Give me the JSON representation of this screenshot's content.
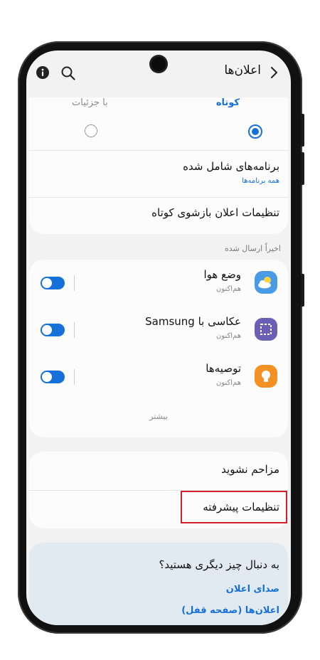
{
  "header": {
    "title": "اعلان‌ها"
  },
  "style_options": {
    "short_label": "کوتاه",
    "detail_label": "با جزئیات",
    "selected": "short"
  },
  "settings": {
    "included_apps": {
      "title": "برنامه‌های شامل شده",
      "subtitle": "همه برنامه‌ها"
    },
    "brief_popup": {
      "title": "تنظیمات اعلان بازشوی کوتاه"
    }
  },
  "recent": {
    "section_label": "اخیراً ارسال شده",
    "apps": [
      {
        "name": "وضع هوا",
        "time": "هم‌اکنون",
        "icon": "weather-icon",
        "enabled": true
      },
      {
        "name": "عکاسی با Samsung",
        "time": "هم‌اکنون",
        "icon": "screenshot-capture-icon",
        "enabled": true
      },
      {
        "name": "توصیه‌ها",
        "time": "هم‌اکنون",
        "icon": "lightbulb-icon",
        "enabled": true
      }
    ],
    "more_label": "بیشتر"
  },
  "bottom": {
    "dnd": "مزاحم نشوید",
    "advanced": "تنظیمات پیشرفته"
  },
  "suggestions": {
    "question": "به دنبال چیز دیگری هستید؟",
    "links": [
      "صدای اعلان",
      "اعلان‌ها (صفحه قفل)"
    ]
  },
  "colors": {
    "accent": "#1670d9",
    "highlight": "#d3202c",
    "background": "#f2f2f2"
  }
}
